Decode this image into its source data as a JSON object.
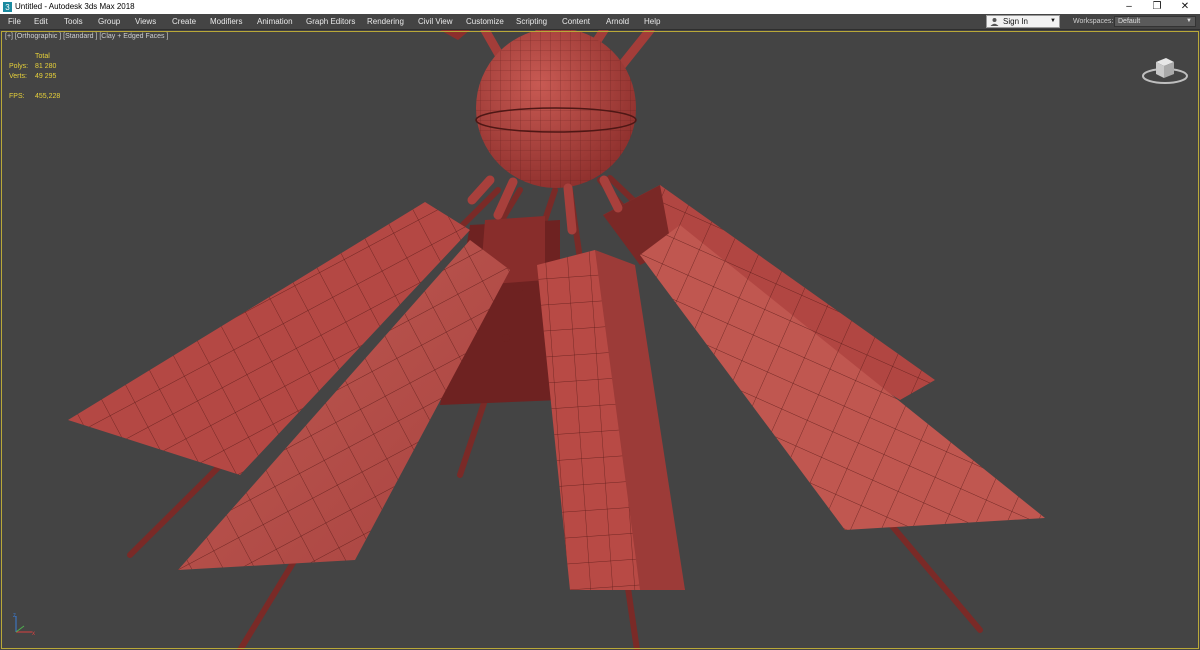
{
  "window": {
    "title": "Untitled - Autodesk 3ds Max 2018",
    "controls": [
      "–",
      "❐",
      "✕"
    ]
  },
  "menu": {
    "items": [
      "File",
      "Edit",
      "Tools",
      "Group",
      "Views",
      "Create",
      "Modifiers",
      "Animation",
      "Graph Editors",
      "Rendering",
      "Civil View",
      "Customize",
      "Scripting",
      "Content",
      "Arnold",
      "Help"
    ]
  },
  "account": {
    "sign_in": "Sign In",
    "workspaces_label": "Workspaces:",
    "workspace_value": "Default"
  },
  "viewport": {
    "label": "[+] [Orthographic ] [Standard ] [Clay + Edged Faces ]",
    "stats": {
      "header": "Total",
      "polys_label": "Polys:",
      "polys_value": "81 280",
      "verts_label": "Verts:",
      "verts_value": "49 295",
      "fps_label": "FPS:",
      "fps_value": "455,228"
    }
  },
  "colors": {
    "viewport_bg": "#444444",
    "clay": "#b84a45",
    "stats_text": "#e8d23a",
    "frame": "#b9a838"
  },
  "icons": [
    "app-icon",
    "user-icon",
    "viewcube-icon",
    "axis-tripod-icon"
  ]
}
